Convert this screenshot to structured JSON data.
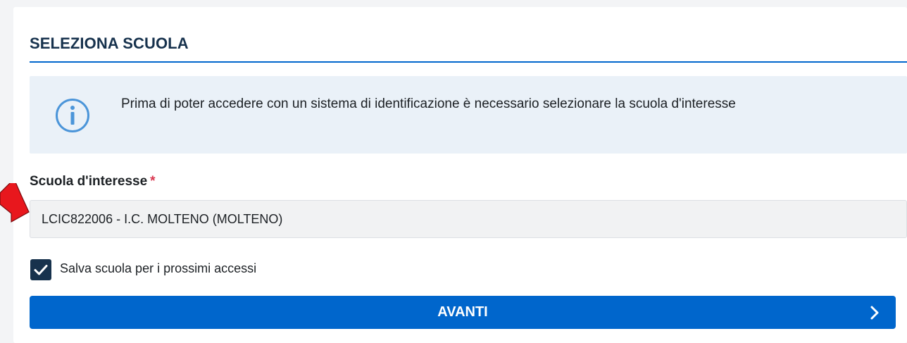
{
  "card": {
    "title": "SELEZIONA SCUOLA"
  },
  "info": {
    "icon": "info-icon",
    "text": "Prima di poter accedere con un sistema di identificazione è necessario selezionare la scuola d'interesse"
  },
  "school": {
    "label": "Scuola d'interesse",
    "required_mark": "*",
    "value": "LCIC822006 - I.C. MOLTENO (MOLTENO)"
  },
  "remember": {
    "checked": true,
    "label": "Salva scuola per i prossimi accessi"
  },
  "submit": {
    "label": "AVANTI",
    "icon": "chevron-right-icon"
  },
  "annotation": {
    "icon": "red-arrow-icon",
    "color": "#e8171d"
  },
  "colors": {
    "primary": "#0066cc",
    "title": "#17324d",
    "info_bg": "#eaf1f8",
    "required": "#d9364f"
  }
}
